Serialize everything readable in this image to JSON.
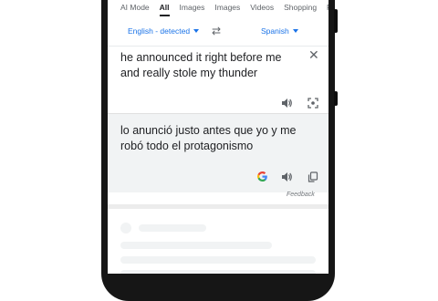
{
  "tabs": [
    "AI Mode",
    "All",
    "Images",
    "Images",
    "Videos",
    "Shopping",
    "Pe"
  ],
  "active_tab_index": 1,
  "translate": {
    "source_language": "English - detected",
    "target_language": "Spanish",
    "source_text": "he announced it right before me and really stole my thunder",
    "translated_text": "lo anunció justo antes que yo y me robó todo el protagonismo",
    "feedback_label": "Feedback"
  },
  "icons": {
    "close": "close-icon",
    "swap": "swap-languages-icon",
    "speaker": "speaker-icon",
    "camera": "lens-camera-icon",
    "google": "google-g-icon",
    "copy": "copy-icon"
  },
  "colors": {
    "accent": "#1a73e8",
    "text": "#202124",
    "muted": "#5f6368",
    "target_bg": "#f1f3f4"
  }
}
